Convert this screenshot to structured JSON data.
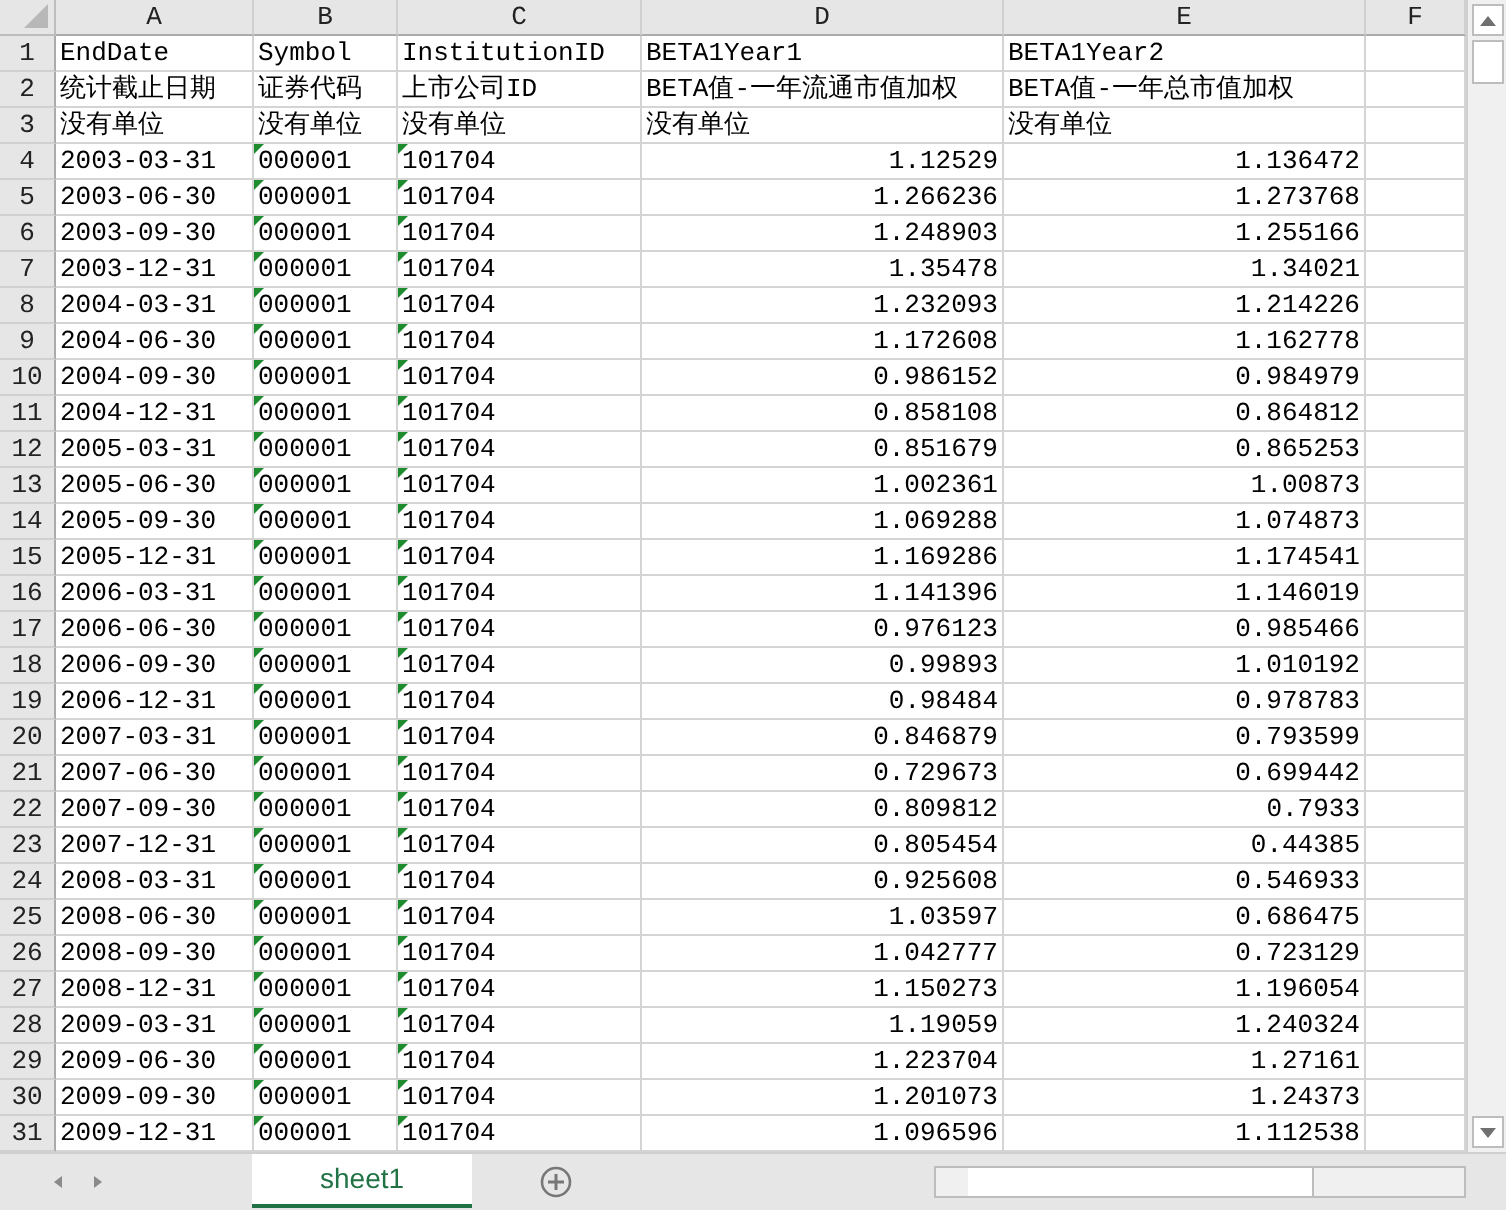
{
  "column_headers": [
    "A",
    "B",
    "C",
    "D",
    "E",
    "F"
  ],
  "columns": [
    {
      "kind": "text"
    },
    {
      "kind": "flagged"
    },
    {
      "kind": "flagged"
    },
    {
      "kind": "number"
    },
    {
      "kind": "number"
    }
  ],
  "header_rows": [
    {
      "number": "1",
      "cells": [
        "EndDate",
        "Symbol",
        "InstitutionID",
        "BETA1Year1",
        "BETA1Year2"
      ]
    },
    {
      "number": "2",
      "cells": [
        "统计截止日期",
        "证券代码",
        "上市公司ID",
        "BETA值-一年流通市值加权",
        "BETA值-一年总市值加权"
      ]
    },
    {
      "number": "3",
      "cells": [
        "没有单位",
        "没有单位",
        "没有单位",
        "没有单位",
        "没有单位"
      ]
    }
  ],
  "data_rows": [
    {
      "number": "4",
      "cells": [
        "2003-03-31",
        "000001",
        "101704",
        "1.12529",
        "1.136472"
      ]
    },
    {
      "number": "5",
      "cells": [
        "2003-06-30",
        "000001",
        "101704",
        "1.266236",
        "1.273768"
      ]
    },
    {
      "number": "6",
      "cells": [
        "2003-09-30",
        "000001",
        "101704",
        "1.248903",
        "1.255166"
      ]
    },
    {
      "number": "7",
      "cells": [
        "2003-12-31",
        "000001",
        "101704",
        "1.35478",
        "1.34021"
      ]
    },
    {
      "number": "8",
      "cells": [
        "2004-03-31",
        "000001",
        "101704",
        "1.232093",
        "1.214226"
      ]
    },
    {
      "number": "9",
      "cells": [
        "2004-06-30",
        "000001",
        "101704",
        "1.172608",
        "1.162778"
      ]
    },
    {
      "number": "10",
      "cells": [
        "2004-09-30",
        "000001",
        "101704",
        "0.986152",
        "0.984979"
      ]
    },
    {
      "number": "11",
      "cells": [
        "2004-12-31",
        "000001",
        "101704",
        "0.858108",
        "0.864812"
      ]
    },
    {
      "number": "12",
      "cells": [
        "2005-03-31",
        "000001",
        "101704",
        "0.851679",
        "0.865253"
      ]
    },
    {
      "number": "13",
      "cells": [
        "2005-06-30",
        "000001",
        "101704",
        "1.002361",
        "1.00873"
      ]
    },
    {
      "number": "14",
      "cells": [
        "2005-09-30",
        "000001",
        "101704",
        "1.069288",
        "1.074873"
      ]
    },
    {
      "number": "15",
      "cells": [
        "2005-12-31",
        "000001",
        "101704",
        "1.169286",
        "1.174541"
      ]
    },
    {
      "number": "16",
      "cells": [
        "2006-03-31",
        "000001",
        "101704",
        "1.141396",
        "1.146019"
      ]
    },
    {
      "number": "17",
      "cells": [
        "2006-06-30",
        "000001",
        "101704",
        "0.976123",
        "0.985466"
      ]
    },
    {
      "number": "18",
      "cells": [
        "2006-09-30",
        "000001",
        "101704",
        "0.99893",
        "1.010192"
      ]
    },
    {
      "number": "19",
      "cells": [
        "2006-12-31",
        "000001",
        "101704",
        "0.98484",
        "0.978783"
      ]
    },
    {
      "number": "20",
      "cells": [
        "2007-03-31",
        "000001",
        "101704",
        "0.846879",
        "0.793599"
      ]
    },
    {
      "number": "21",
      "cells": [
        "2007-06-30",
        "000001",
        "101704",
        "0.729673",
        "0.699442"
      ]
    },
    {
      "number": "22",
      "cells": [
        "2007-09-30",
        "000001",
        "101704",
        "0.809812",
        "0.7933"
      ]
    },
    {
      "number": "23",
      "cells": [
        "2007-12-31",
        "000001",
        "101704",
        "0.805454",
        "0.44385"
      ]
    },
    {
      "number": "24",
      "cells": [
        "2008-03-31",
        "000001",
        "101704",
        "0.925608",
        "0.546933"
      ]
    },
    {
      "number": "25",
      "cells": [
        "2008-06-30",
        "000001",
        "101704",
        "1.03597",
        "0.686475"
      ]
    },
    {
      "number": "26",
      "cells": [
        "2008-09-30",
        "000001",
        "101704",
        "1.042777",
        "0.723129"
      ]
    },
    {
      "number": "27",
      "cells": [
        "2008-12-31",
        "000001",
        "101704",
        "1.150273",
        "1.196054"
      ]
    },
    {
      "number": "28",
      "cells": [
        "2009-03-31",
        "000001",
        "101704",
        "1.19059",
        "1.240324"
      ]
    },
    {
      "number": "29",
      "cells": [
        "2009-06-30",
        "000001",
        "101704",
        "1.223704",
        "1.27161"
      ]
    },
    {
      "number": "30",
      "cells": [
        "2009-09-30",
        "000001",
        "101704",
        "1.201073",
        "1.24373"
      ]
    },
    {
      "number": "31",
      "cells": [
        "2009-12-31",
        "000001",
        "101704",
        "1.096596",
        "1.112538"
      ]
    }
  ],
  "sheet_tabs": [
    {
      "label": "sheet1",
      "selected": true
    }
  ]
}
